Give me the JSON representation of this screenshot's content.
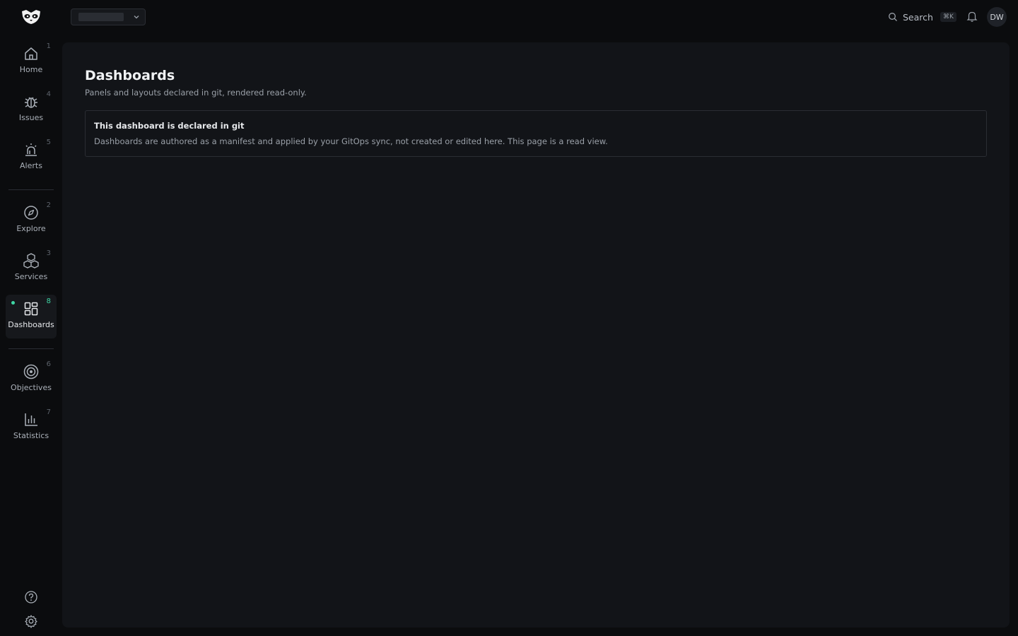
{
  "topbar": {
    "search_label": "Search",
    "search_shortcut": "⌘K",
    "avatar_initials": "DW"
  },
  "sidebar": {
    "items": [
      {
        "label": "Home",
        "shortcut": "1",
        "icon": "home-icon"
      },
      {
        "label": "Issues",
        "shortcut": "4",
        "icon": "bug-icon"
      },
      {
        "label": "Alerts",
        "shortcut": "5",
        "icon": "siren-icon"
      },
      {
        "label": "Explore",
        "shortcut": "2",
        "icon": "compass-icon"
      },
      {
        "label": "Services",
        "shortcut": "3",
        "icon": "cubes-icon"
      },
      {
        "label": "Dashboards",
        "shortcut": "8",
        "icon": "grid-icon",
        "active": true
      },
      {
        "label": "Objectives",
        "shortcut": "6",
        "icon": "target-icon"
      },
      {
        "label": "Statistics",
        "shortcut": "7",
        "icon": "bar-chart-icon"
      }
    ],
    "bottom": [
      "help-icon",
      "gear-icon"
    ]
  },
  "main": {
    "title": "Dashboards",
    "subtitle": "Panels and layouts declared in git, rendered read-only.",
    "notice": {
      "title": "This dashboard is declared in git",
      "body": "Dashboards are authored as a manifest and applied by your GitOps sync, not created or edited here. This page is a read view."
    }
  },
  "colors": {
    "accent": "#3fd7a5",
    "background": "#0b0c0e",
    "panel": "#121418"
  }
}
